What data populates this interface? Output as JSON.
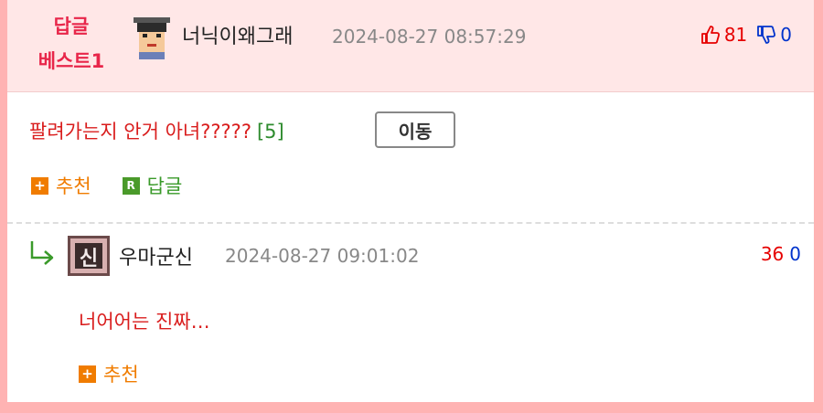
{
  "best_comment": {
    "badge_line1": "답글",
    "badge_line2": "베스트1",
    "author": "너닉이왜그래",
    "timestamp": "2024-08-27 08:57:29",
    "upvotes": "81",
    "downvotes": "0",
    "text": "팔려가는지 안거 아녀?????",
    "reply_count": "[5]",
    "move_button": "이동",
    "recommend_label": "추천",
    "reply_label": "답글",
    "reply_icon_letter": "R",
    "plus_icon": "+"
  },
  "reply": {
    "author": "우마군신",
    "timestamp": "2024-08-27 09:01:02",
    "upvotes": "36",
    "downvotes": "0",
    "text": "너어어는 진짜…",
    "recommend_label": "추천",
    "plus_icon": "+"
  },
  "colors": {
    "page_border": "#ffb3b3",
    "header_bg": "#ffe7e7",
    "badge_red": "#e8264a",
    "comment_text_red": "#d91c1c",
    "orange": "#f07c00",
    "green": "#3a9a2a",
    "upvote_red": "#e60000",
    "downvote_blue": "#0033cc"
  },
  "icons": [
    "user-avatar-icon",
    "thumbs-up-icon",
    "thumbs-down-icon",
    "plus-icon",
    "reply-r-icon",
    "reply-arrow-icon"
  ]
}
